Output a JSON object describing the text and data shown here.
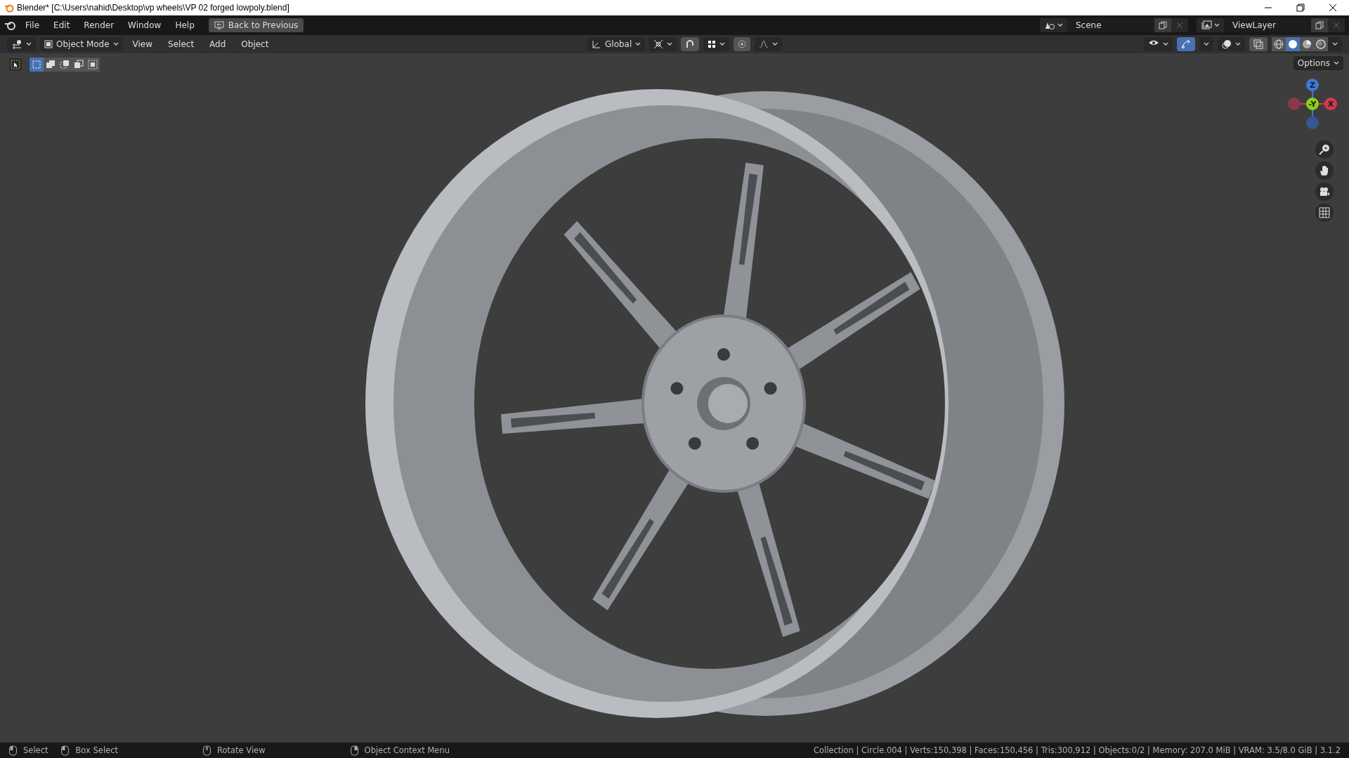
{
  "title_bar": {
    "title": "Blender* [C:\\Users\\nahid\\Desktop\\vp wheels\\VP 02 forged lowpoly.blend]"
  },
  "menu": [
    "File",
    "Edit",
    "Render",
    "Window",
    "Help"
  ],
  "back_button": {
    "label": "Back to Previous"
  },
  "scene": {
    "name": "Scene"
  },
  "view_layer": {
    "name": "ViewLayer"
  },
  "header": {
    "mode": "Object Mode",
    "menus": [
      "View",
      "Select",
      "Add",
      "Object"
    ],
    "orientation": "Global",
    "snap_on": false,
    "gizmos_on": true,
    "options": "Options"
  },
  "shading": [
    {
      "kind": "wireframe",
      "selected": false
    },
    {
      "kind": "solid",
      "selected": true
    },
    {
      "kind": "material",
      "selected": false
    },
    {
      "kind": "rendered",
      "selected": false
    }
  ],
  "select_modes": [
    {
      "kind": "set",
      "selected": true
    },
    {
      "kind": "extend",
      "selected": false
    },
    {
      "kind": "subtract",
      "selected": false
    },
    {
      "kind": "invert",
      "selected": false
    },
    {
      "kind": "intersect",
      "selected": false
    }
  ],
  "gizmo": {
    "z": "Z",
    "y": "-Y",
    "x": "X"
  },
  "status_bar": {
    "hints": [
      {
        "label": "Select",
        "kind": "left"
      },
      {
        "label": "Box Select",
        "kind": "drag"
      },
      {
        "label": "Rotate View",
        "kind": "middle"
      },
      {
        "label": "Object Context Menu",
        "kind": "right"
      }
    ],
    "stats": "Collection | Circle.004 | Verts:150,398 | Faces:150,456 | Tris:300,912 | Objects:0/2 | Memory: 207.0 MiB | VRAM: 3.5/8.0 GiB | 3.1.2"
  }
}
